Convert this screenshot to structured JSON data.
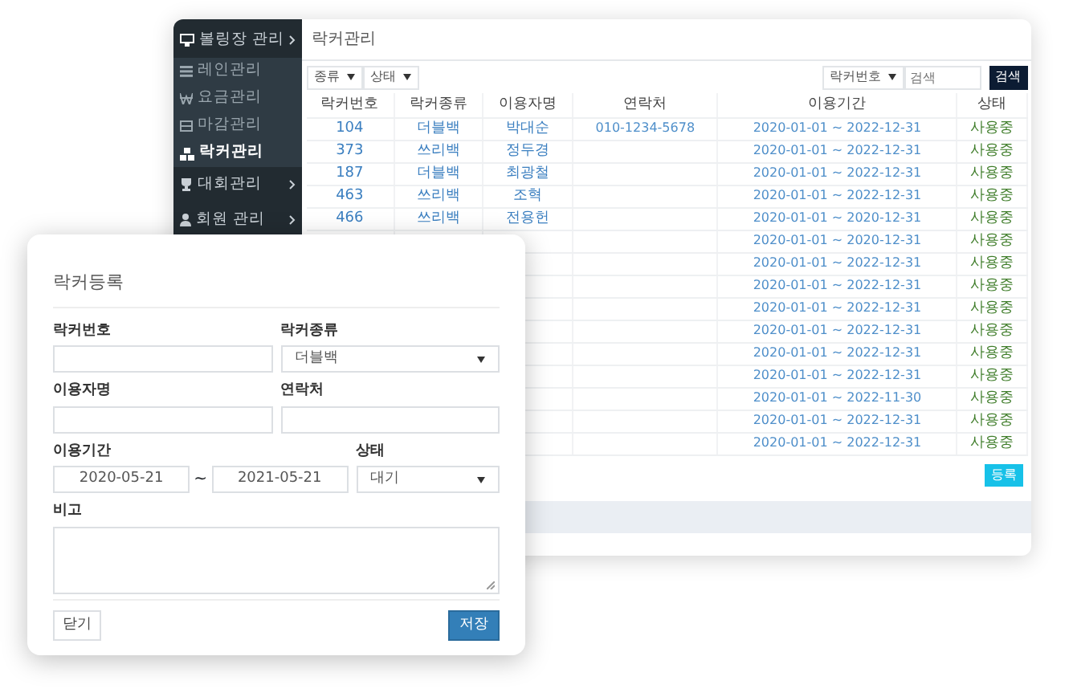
{
  "sidebar": {
    "items": [
      {
        "label": "볼링장 관리",
        "kind": "group",
        "selected": false
      },
      {
        "label": "레인관리",
        "kind": "sub",
        "selected": false
      },
      {
        "label": "요금관리",
        "kind": "sub",
        "selected": false
      },
      {
        "label": "마감관리",
        "kind": "sub",
        "selected": false
      },
      {
        "label": "락커관리",
        "kind": "sub",
        "selected": true
      },
      {
        "label": "대회관리",
        "kind": "group",
        "selected": false
      },
      {
        "label": "회원 관리",
        "kind": "group",
        "selected": false
      }
    ]
  },
  "page": {
    "title": "락커관리",
    "filters": [
      {
        "label": "종류"
      },
      {
        "label": "상태"
      }
    ],
    "search": {
      "field": "락커번호",
      "placeholder": "검색",
      "button": "검색"
    },
    "table": {
      "columns": [
        "락커번호",
        "락커종류",
        "이용자명",
        "연락처",
        "이용기간",
        "상태"
      ],
      "rows": [
        {
          "number": "104",
          "type": "더블백",
          "user": "박대순",
          "phone": "010-1234-5678",
          "period": "2020-01-01 ~ 2022-12-31",
          "status": "사용중"
        },
        {
          "number": "373",
          "type": "쓰리백",
          "user": "정두경",
          "period": "2020-01-01 ~ 2022-12-31",
          "status": "사용중"
        },
        {
          "number": "187",
          "type": "더블백",
          "user": "최광철",
          "period": "2020-01-01 ~ 2022-12-31",
          "status": "사용중"
        },
        {
          "number": "463",
          "type": "쓰리백",
          "user": "조혁",
          "period": "2020-01-01 ~ 2022-12-31",
          "status": "사용중"
        },
        {
          "number": "466",
          "type": "쓰리백",
          "user": "전용헌",
          "period": "2020-01-01 ~ 2020-12-31",
          "status": "사용중"
        },
        {
          "period": "2020-01-01 ~ 2020-12-31",
          "status": "사용중"
        },
        {
          "period": "2020-01-01 ~ 2022-12-31",
          "status": "사용중"
        },
        {
          "period": "2020-01-01 ~ 2022-12-31",
          "status": "사용중"
        },
        {
          "period": "2020-01-01 ~ 2022-12-31",
          "status": "사용중"
        },
        {
          "period": "2020-01-01 ~ 2022-12-31",
          "status": "사용중"
        },
        {
          "period": "2020-01-01 ~ 2022-12-31",
          "status": "사용중"
        },
        {
          "period": "2020-01-01 ~ 2022-12-31",
          "status": "사용중"
        },
        {
          "period": "2020-01-01 ~ 2022-11-30",
          "status": "사용중"
        },
        {
          "period": "2020-01-01 ~ 2022-12-31",
          "status": "사용중"
        },
        {
          "period": "2020-01-01 ~ 2022-12-31",
          "status": "사용중"
        }
      ]
    },
    "add_button": "등록"
  },
  "modal": {
    "title": "락커등록",
    "fields": [
      {
        "kind": "text",
        "label": "락커번호"
      },
      {
        "kind": "select",
        "label": "락커종류",
        "value": "더블백"
      },
      {
        "kind": "text",
        "label": "이용자명"
      },
      {
        "kind": "text",
        "label": "연락처"
      },
      {
        "kind": "daterange",
        "label": "이용기간",
        "from": "2020-05-21",
        "separator": "~",
        "to": "2021-05-21"
      },
      {
        "kind": "select",
        "label": "상태",
        "value": "대기"
      },
      {
        "kind": "textarea",
        "label": "비고"
      }
    ],
    "buttons": [
      {
        "label": "닫기",
        "kind": "secondary"
      },
      {
        "label": "저장",
        "kind": "primary"
      }
    ]
  }
}
